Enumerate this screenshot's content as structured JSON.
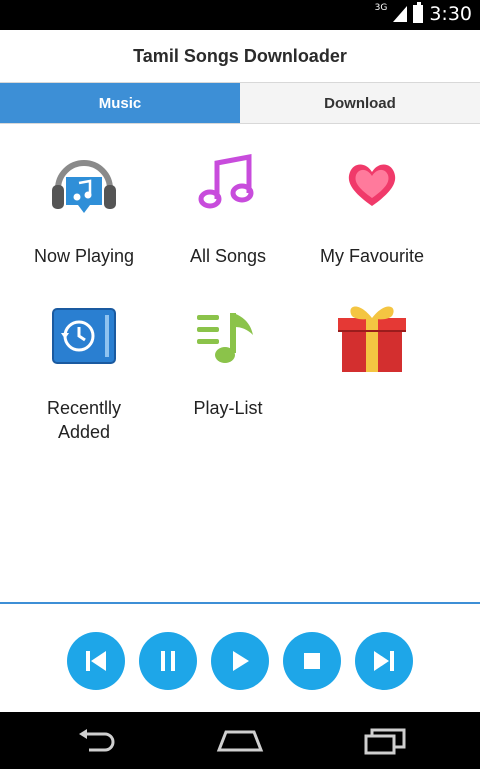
{
  "status_bar": {
    "network": "3G",
    "time": "3:30"
  },
  "app": {
    "title": "Tamil Songs Downloader"
  },
  "tabs": [
    {
      "label": "Music",
      "active": true
    },
    {
      "label": "Download",
      "active": false
    }
  ],
  "grid": [
    {
      "label": "Now Playing",
      "icon": "headphones-icon"
    },
    {
      "label": "All Songs",
      "icon": "music-note-icon"
    },
    {
      "label": "My Favourite",
      "icon": "heart-icon"
    },
    {
      "label_line1": "Recentlly",
      "label_line2": "Added",
      "icon": "history-clock-icon"
    },
    {
      "label": "Play-List",
      "icon": "playlist-icon"
    },
    {
      "label": "",
      "icon": "gift-icon"
    }
  ],
  "player": {
    "buttons": [
      "previous",
      "pause",
      "play",
      "stop",
      "next"
    ]
  },
  "colors": {
    "accent": "#3d8fd6",
    "control": "#1ea6e8"
  }
}
